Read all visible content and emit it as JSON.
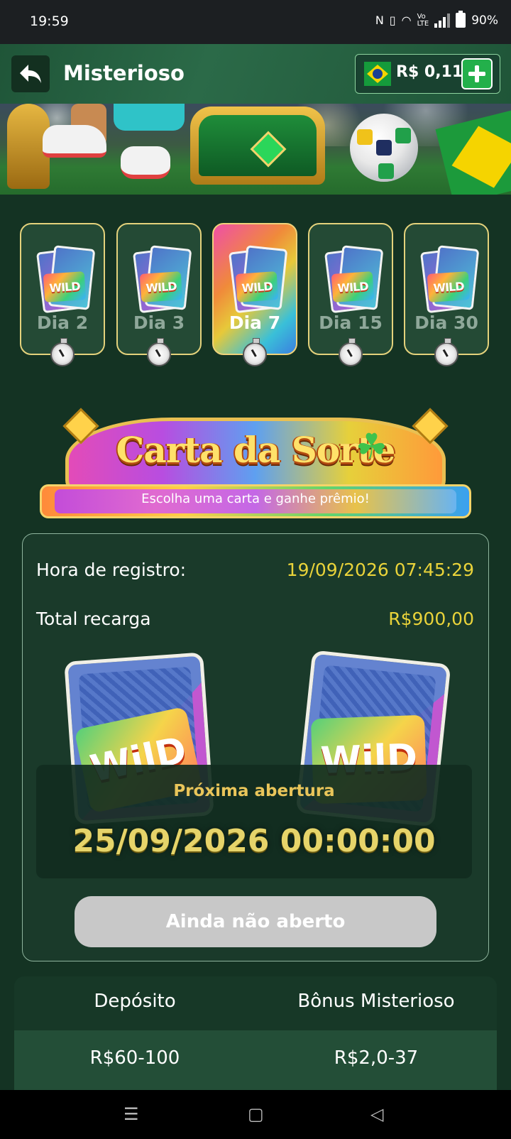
{
  "status_bar": {
    "time": "19:59",
    "battery": "90%"
  },
  "header": {
    "title": "Misterioso",
    "balance": "R$ 0,11"
  },
  "days": [
    {
      "label": "Dia 2",
      "active": false,
      "card_text": "WILD"
    },
    {
      "label": "Dia 3",
      "active": false,
      "card_text": "WILD"
    },
    {
      "label": "Dia 7",
      "active": true,
      "card_text": "WILD"
    },
    {
      "label": "Dia 15",
      "active": false,
      "card_text": "WILD"
    },
    {
      "label": "Dia 30",
      "active": false,
      "card_text": "WILD"
    }
  ],
  "promo": {
    "title": "Carta da Sorte",
    "subtitle": "Escolha uma carta e ganhe prêmio!"
  },
  "info": {
    "registration_label": "Hora de registro:",
    "registration_value": "19/09/2026 07:45:29",
    "recharge_label": "Total recarga",
    "recharge_value": "R$900,00",
    "card_text": "WilD"
  },
  "countdown": {
    "label": "Próxima abertura",
    "value": "25/09/2026 00:00:00"
  },
  "action": {
    "label": "Ainda não aberto"
  },
  "table": {
    "headers": [
      "Depósito",
      "Bônus Misterioso"
    ],
    "rows": [
      [
        "R$60-100",
        "R$2,0-37"
      ]
    ]
  },
  "colors": {
    "accent_green": "#23b04b",
    "value_yellow": "#e9d33a",
    "background": "#143323"
  }
}
